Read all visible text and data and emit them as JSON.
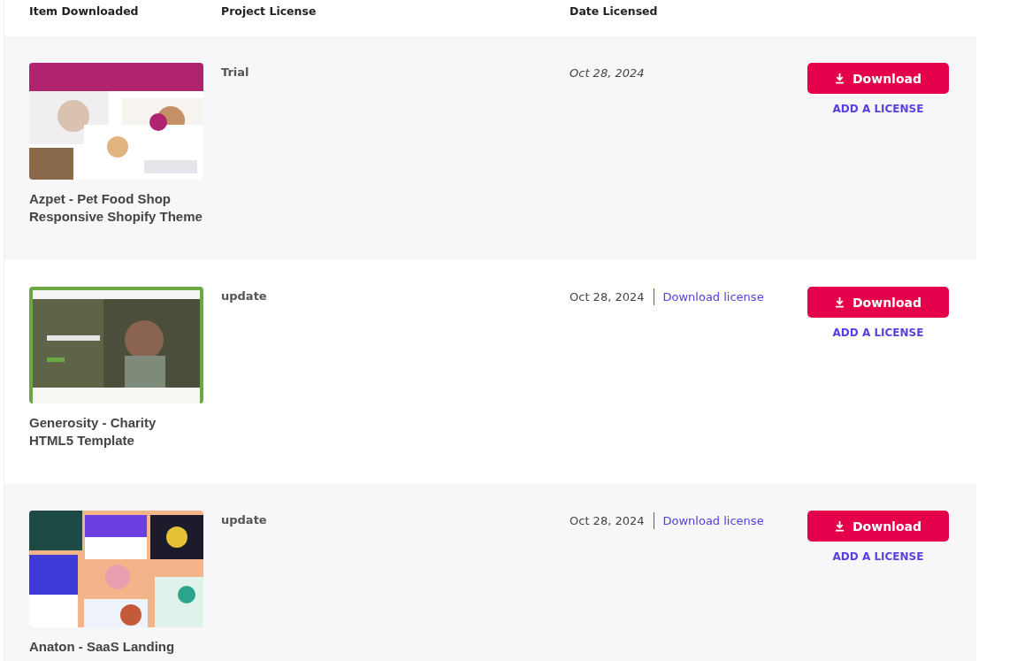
{
  "columns": [
    "Item Downloaded",
    "Project License",
    "Date Licensed"
  ],
  "rows": [
    {
      "title": "Azpet - Pet Food Shop Responsive Shopify Theme",
      "license": "Trial",
      "date": "Oct 28, 2024",
      "date_italic": true,
      "button": "Download",
      "add_license": "ADD A LICENSE"
    },
    {
      "title": "Generosity - Charity HTML5 Template",
      "license": "update",
      "date": "Oct 28, 2024",
      "date_italic": false,
      "license_link": "Download license",
      "button": "Download",
      "add_license": "ADD A LICENSE"
    },
    {
      "title": "Anaton - SaaS Landing",
      "license": "update",
      "date": "Oct 28, 2024",
      "date_italic": false,
      "license_link": "Download license",
      "button": "Download",
      "add_license": "ADD A LICENSE"
    }
  ]
}
